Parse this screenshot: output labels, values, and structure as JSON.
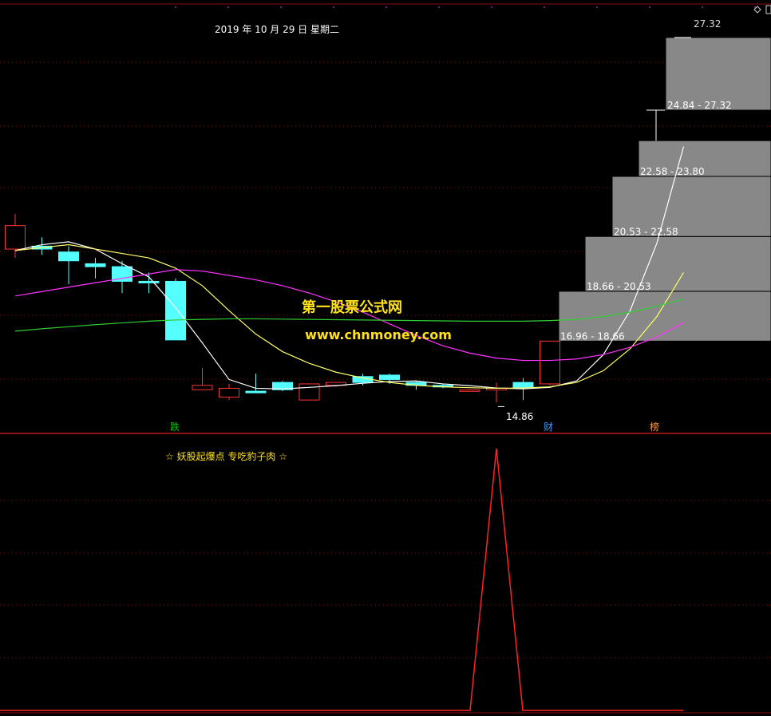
{
  "header": {
    "date_label": "2019 年 10 月 29 日 星期二"
  },
  "watermark": {
    "title": "第一股票公式网",
    "url": "www.chnmoney.com"
  },
  "indicator": {
    "title": "☆ 妖股起爆点 专吃豹子肉 ☆"
  },
  "tags": [
    {
      "text": "跌",
      "color": "#00cc00"
    },
    {
      "text": "财",
      "color": "#3399ff"
    },
    {
      "text": "榜",
      "color": "#ff9933"
    }
  ],
  "annotations": {
    "low_price": "14.86",
    "high_price": "27.32"
  },
  "colors": {
    "up": "#ff3333",
    "down": "#54ffff",
    "ma_short": "#ffffff",
    "ma_mid": "#ffff66",
    "ma_long": "#ff33ff",
    "ma_longest": "#33cc33",
    "box": "#888888",
    "grid": "#8a1010",
    "signal": "#ff2222"
  },
  "chart_data": [
    {
      "type": "candlestick",
      "name": "price",
      "candles": [
        {
          "open": 20.1,
          "close": 20.9,
          "high": 21.3,
          "low": 19.8
        },
        {
          "open": 20.2,
          "close": 20.1,
          "high": 20.5,
          "low": 19.9
        },
        {
          "open": 20.0,
          "close": 19.7,
          "high": 20.2,
          "low": 18.9
        },
        {
          "open": 19.6,
          "close": 19.5,
          "high": 19.8,
          "low": 19.1
        },
        {
          "open": 19.5,
          "close": 19.0,
          "high": 19.7,
          "low": 18.6
        },
        {
          "open": 19.0,
          "close": 18.95,
          "high": 19.3,
          "low": 18.6
        },
        {
          "open": 19.0,
          "close": 17.0,
          "high": 19.1,
          "low": 17.0
        },
        {
          "open": 15.3,
          "close": 15.45,
          "high": 16.05,
          "low": 15.3
        },
        {
          "open": 15.05,
          "close": 15.35,
          "high": 15.5,
          "low": 14.95
        },
        {
          "open": 15.25,
          "close": 15.2,
          "high": 15.85,
          "low": 15.2
        },
        {
          "open": 15.55,
          "close": 15.3,
          "high": 15.6,
          "low": 15.25
        },
        {
          "open": 14.95,
          "close": 15.5,
          "high": 15.5,
          "low": 14.95
        },
        {
          "open": 15.45,
          "close": 15.55,
          "high": 15.55,
          "low": 15.4
        },
        {
          "open": 15.75,
          "close": 15.55,
          "high": 15.85,
          "low": 15.45
        },
        {
          "open": 15.8,
          "close": 15.65,
          "high": 15.85,
          "low": 15.5
        },
        {
          "open": 15.55,
          "close": 15.45,
          "high": 15.6,
          "low": 15.3
        },
        {
          "open": 15.45,
          "close": 15.42,
          "high": 15.5,
          "low": 15.35
        },
        {
          "open": 15.25,
          "close": 15.3,
          "high": 15.3,
          "low": 15.25
        },
        {
          "open": 15.3,
          "close": 15.35,
          "high": 15.55,
          "low": 14.86
        },
        {
          "open": 15.55,
          "close": 15.35,
          "high": 15.7,
          "low": 14.95
        },
        {
          "open": 15.5,
          "close": 16.96,
          "high": 16.96,
          "low": 15.45
        }
      ]
    },
    {
      "type": "line",
      "name": "ma",
      "x": [
        0,
        1,
        2,
        3,
        4,
        5,
        6,
        7,
        8,
        9,
        10,
        11,
        12,
        13,
        14,
        15,
        16,
        17,
        18,
        19,
        20,
        21,
        22,
        23,
        24,
        25
      ],
      "series": [
        {
          "key": "ma_short",
          "values": [
            20.05,
            20.25,
            20.35,
            20.1,
            19.6,
            19.15,
            18.1,
            16.9,
            15.65,
            15.35,
            15.33,
            15.38,
            15.44,
            15.52,
            15.58,
            15.6,
            15.5,
            15.44,
            15.36,
            15.33,
            15.38,
            15.6,
            16.5,
            18.0,
            20.3,
            23.6
          ]
        },
        {
          "key": "ma_mid",
          "values": [
            20.05,
            20.15,
            20.25,
            20.1,
            19.95,
            19.8,
            19.45,
            18.85,
            18.0,
            17.2,
            16.6,
            16.2,
            15.9,
            15.7,
            15.55,
            15.45,
            15.4,
            15.37,
            15.35,
            15.36,
            15.4,
            15.55,
            15.95,
            16.7,
            17.8,
            19.3
          ]
        },
        {
          "key": "ma_long",
          "values": [
            18.5,
            18.65,
            18.8,
            18.95,
            19.1,
            19.25,
            19.4,
            19.35,
            19.2,
            19.05,
            18.85,
            18.6,
            18.3,
            17.95,
            17.55,
            17.15,
            16.8,
            16.55,
            16.38,
            16.3,
            16.3,
            16.35,
            16.5,
            16.75,
            17.1,
            17.6
          ]
        },
        {
          "key": "ma_longest",
          "values": [
            17.3,
            17.38,
            17.45,
            17.52,
            17.58,
            17.64,
            17.68,
            17.7,
            17.72,
            17.72,
            17.71,
            17.7,
            17.69,
            17.68,
            17.67,
            17.66,
            17.65,
            17.64,
            17.64,
            17.64,
            17.66,
            17.7,
            17.8,
            17.95,
            18.15,
            18.4
          ]
        }
      ],
      "ylim": [
        14,
        28
      ]
    },
    {
      "type": "bar",
      "name": "price-boxes",
      "boxes": [
        {
          "low": 16.96,
          "high": 18.66,
          "label": "16.96 - 18.66"
        },
        {
          "low": 18.66,
          "high": 20.53,
          "label": "18.66 - 20.53"
        },
        {
          "low": 20.53,
          "high": 22.58,
          "label": "20.53 - 22.58"
        },
        {
          "low": 22.58,
          "high": 23.8,
          "label": "22.58 - 23.80"
        },
        {
          "low": 23.8,
          "high": 24.84,
          "label": ""
        },
        {
          "low": 24.84,
          "high": 27.32,
          "label": "24.84 - 27.32"
        }
      ]
    },
    {
      "type": "line",
      "name": "signal",
      "values": [
        0,
        0,
        0,
        0,
        0,
        0,
        0,
        0,
        0,
        0,
        0,
        0,
        0,
        0,
        0,
        0,
        0,
        0,
        1,
        0,
        0,
        0,
        0,
        0,
        0,
        0
      ],
      "ylim": [
        0,
        1
      ]
    }
  ]
}
